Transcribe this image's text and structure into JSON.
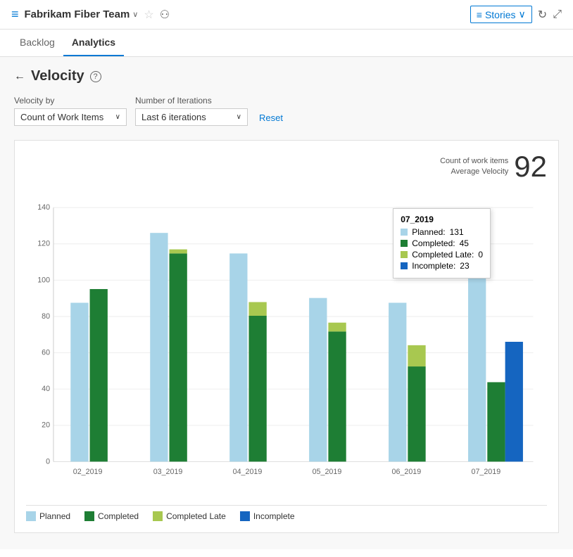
{
  "header": {
    "icon": "≡",
    "team_name": "Fabrikam Fiber Team",
    "chevron": "∨",
    "stories_label": "Stories",
    "stories_chevron": "∨"
  },
  "tabs": [
    {
      "id": "backlog",
      "label": "Backlog",
      "active": false
    },
    {
      "id": "analytics",
      "label": "Analytics",
      "active": true
    }
  ],
  "page": {
    "title": "Velocity",
    "back_label": "←"
  },
  "filters": {
    "velocity_by_label": "Velocity by",
    "velocity_by_value": "Count of Work Items",
    "iterations_label": "Number of Iterations",
    "iterations_value": "Last 6 iterations",
    "reset_label": "Reset"
  },
  "chart": {
    "avg_velocity_label": "Count of work items\nAverage Velocity",
    "avg_velocity_value": "92",
    "y_axis": [
      0,
      20,
      40,
      60,
      80,
      100,
      120,
      140
    ],
    "bars": [
      {
        "sprint": "02_2019",
        "planned": 90,
        "completed": 98,
        "completed_late": 0,
        "incomplete": 0
      },
      {
        "sprint": "03_2019",
        "planned": 130,
        "completed": 118,
        "completed_late": 0,
        "incomplete": 0
      },
      {
        "sprint": "04_2019",
        "planned": 118,
        "completed": 83,
        "completed_late": 8,
        "incomplete": 0
      },
      {
        "sprint": "05_2019",
        "planned": 93,
        "completed": 74,
        "completed_late": 5,
        "incomplete": 0
      },
      {
        "sprint": "06_2019",
        "planned": 90,
        "completed": 54,
        "completed_late": 12,
        "incomplete": 0
      },
      {
        "sprint": "07_2019",
        "planned": 131,
        "completed": 45,
        "completed_late": 0,
        "incomplete": 23
      }
    ],
    "tooltip": {
      "sprint": "07_2019",
      "planned_label": "Planned:",
      "planned_value": "131",
      "completed_label": "Completed:",
      "completed_value": "45",
      "completed_late_label": "Completed Late:",
      "completed_late_value": "0",
      "incomplete_label": "Incomplete:",
      "incomplete_value": "23"
    },
    "legend": [
      {
        "id": "planned",
        "label": "Planned",
        "color": "#a8d4e8"
      },
      {
        "id": "completed",
        "label": "Completed",
        "color": "#1e7e34"
      },
      {
        "id": "completed_late",
        "label": "Completed Late",
        "color": "#8bc34a"
      },
      {
        "id": "incomplete",
        "label": "Incomplete",
        "color": "#1565c0"
      }
    ]
  }
}
